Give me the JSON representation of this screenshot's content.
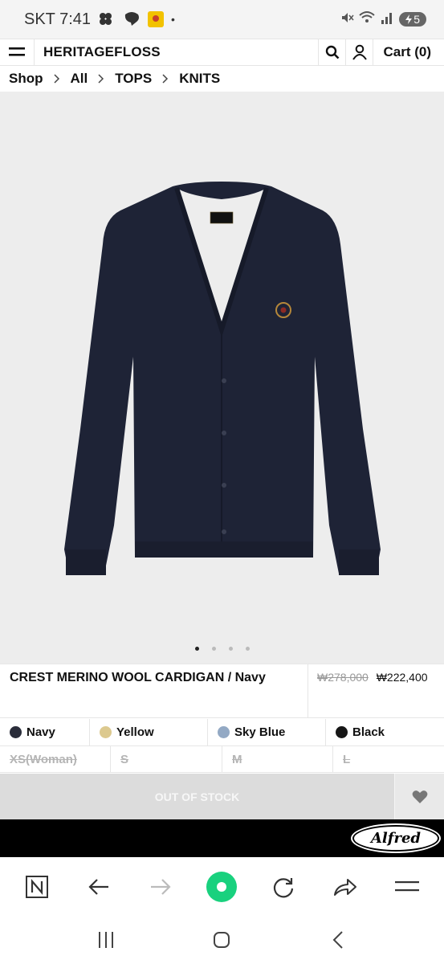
{
  "status_bar": {
    "carrier_time": "SKT 7:41",
    "dot": "•",
    "battery": "5"
  },
  "header": {
    "brand": "HERITAGEFLOSS",
    "cart_label": "Cart (0)"
  },
  "breadcrumb": [
    "Shop",
    "All",
    "TOPS",
    "KNITS"
  ],
  "gallery": {
    "image_count": 4,
    "active_index": 0
  },
  "product": {
    "title": "CREST MERINO WOOL CARDIGAN / Navy",
    "original_price": "₩278,000",
    "sale_price": "₩222,400"
  },
  "colors": [
    {
      "name": "Navy",
      "hex": "#2a2d3a"
    },
    {
      "name": "Yellow",
      "hex": "#dcc98f"
    },
    {
      "name": "Sky Blue",
      "hex": "#93a9c4"
    },
    {
      "name": "Black",
      "hex": "#161616"
    }
  ],
  "sizes": [
    "XS(Woman)",
    "S",
    "M",
    "L"
  ],
  "buy": {
    "status_label": "OUT OF STOCK"
  },
  "banner": {
    "logo_text": "Alfred"
  },
  "theme": {
    "accent": "#19d17e"
  }
}
